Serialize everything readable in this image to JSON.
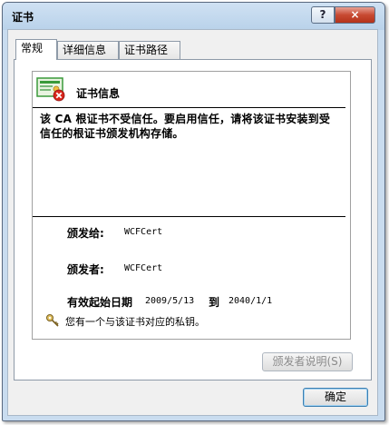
{
  "window": {
    "title": "证书"
  },
  "titlebar": {
    "help_label": "?",
    "close_label": "×"
  },
  "tabs": [
    {
      "label": "常规",
      "active": true
    },
    {
      "label": "详细信息",
      "active": false
    },
    {
      "label": "证书路径",
      "active": false
    }
  ],
  "certificate": {
    "section_title": "证书信息",
    "warning": "该 CA 根证书不受信任。要启用信任，请将该证书安装到受信任的根证书颁发机构存储。",
    "issued_to_label": "颁发给:",
    "issued_to": "WCFCert",
    "issued_by_label": "颁发者:",
    "issued_by": "WCFCert",
    "valid_label": "有效起始日期",
    "valid_from": "2009/5/13",
    "valid_to_label": "到",
    "valid_to": "2040/1/1",
    "private_key_note": "您有一个与该证书对应的私钥。"
  },
  "buttons": {
    "issuer_statement": "颁发者说明(S)",
    "ok": "确定"
  },
  "colors": {
    "title_gradient": "#bfd6ec",
    "close_button": "#c74a32",
    "error_badge": "#d9261c",
    "cert_green": "#3a9a3a"
  }
}
